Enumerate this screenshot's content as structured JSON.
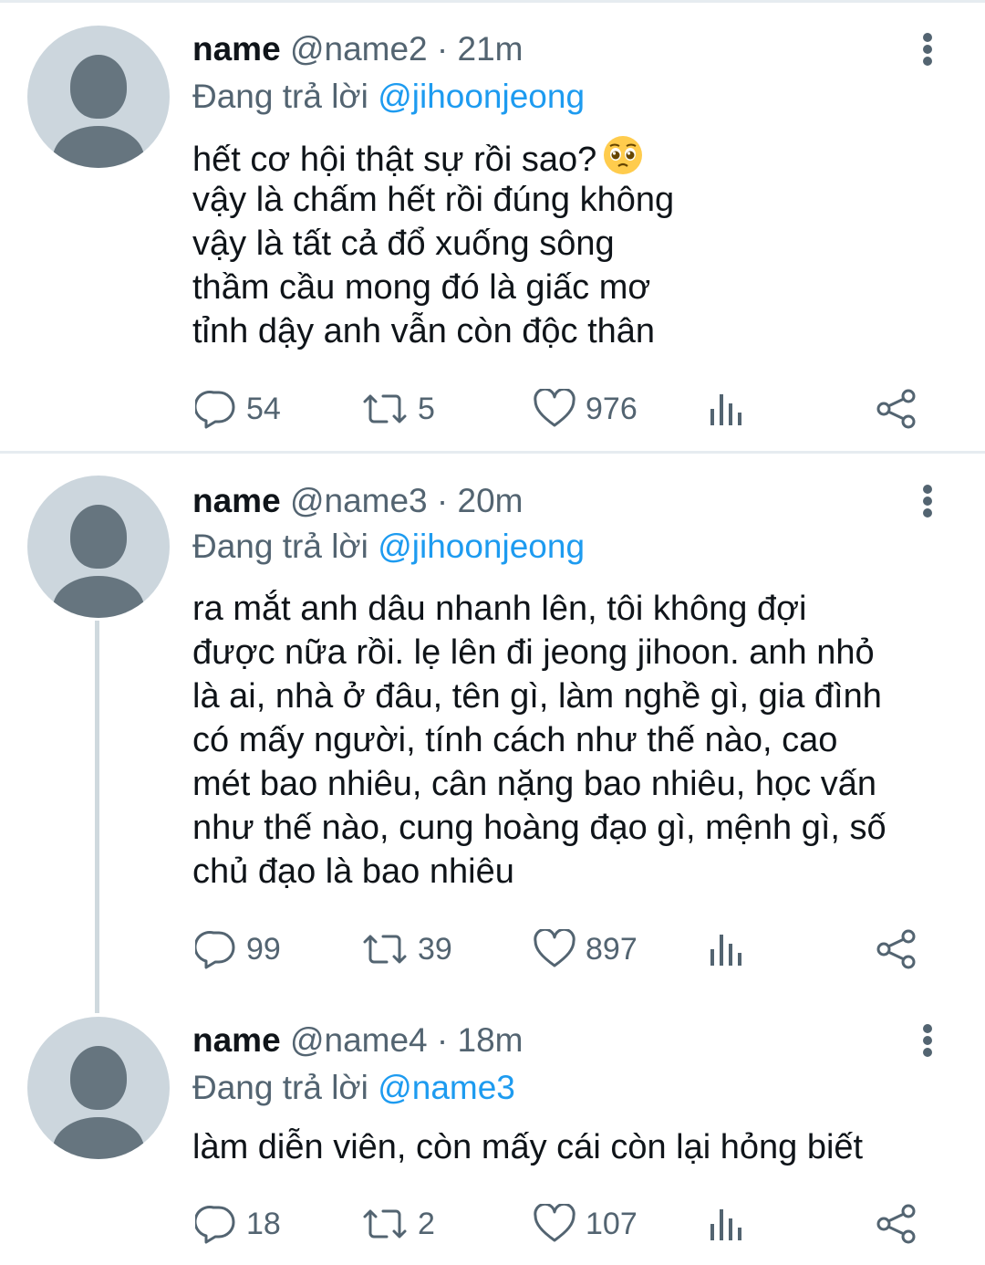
{
  "reply_prefix": "Đang trả lời",
  "tweets": [
    {
      "name": "name",
      "handle": "@name2",
      "separator": "·",
      "time": "21m",
      "replying_to": "@jihoonjeong",
      "lines": [
        "hết cơ hội thật sự rồi sao?",
        "vậy là chấm hết rồi đúng không",
        "vậy là tất cả đổ xuống sông",
        "thầm cầu mong đó là giấc mơ",
        "tỉnh dậy anh vẫn còn độc thân"
      ],
      "emoji": "pleading-face",
      "replies": "54",
      "retweets": "5",
      "likes": "976"
    },
    {
      "name": "name",
      "handle": "@name3",
      "separator": "·",
      "time": "20m",
      "replying_to": "@jihoonjeong",
      "lines": [
        "ra mắt anh dâu nhanh lên, tôi không đợi",
        "được nữa rồi. lẹ lên đi jeong jihoon. anh nhỏ",
        "là ai, nhà ở đâu, tên gì, làm nghề gì, gia đình",
        "có mấy người, tính cách như thế nào, cao",
        "mét bao nhiêu, cân nặng bao nhiêu, học vấn",
        "như thế nào, cung hoàng đạo gì, mệnh gì, số",
        "chủ đạo là bao nhiêu"
      ],
      "replies": "99",
      "retweets": "39",
      "likes": "897"
    },
    {
      "name": "name",
      "handle": "@name4",
      "separator": "·",
      "time": "18m",
      "replying_to": "@name3",
      "lines": [
        "làm diễn viên, còn mấy cái còn lại hỏng biết"
      ],
      "replies": "18",
      "retweets": "2",
      "likes": "107"
    }
  ],
  "colors": {
    "text": "#0f1419",
    "secondary": "#536471",
    "mention": "#1d9bf0",
    "avatar_bg": "#ccd6dd",
    "avatar_fg": "#66757f"
  }
}
